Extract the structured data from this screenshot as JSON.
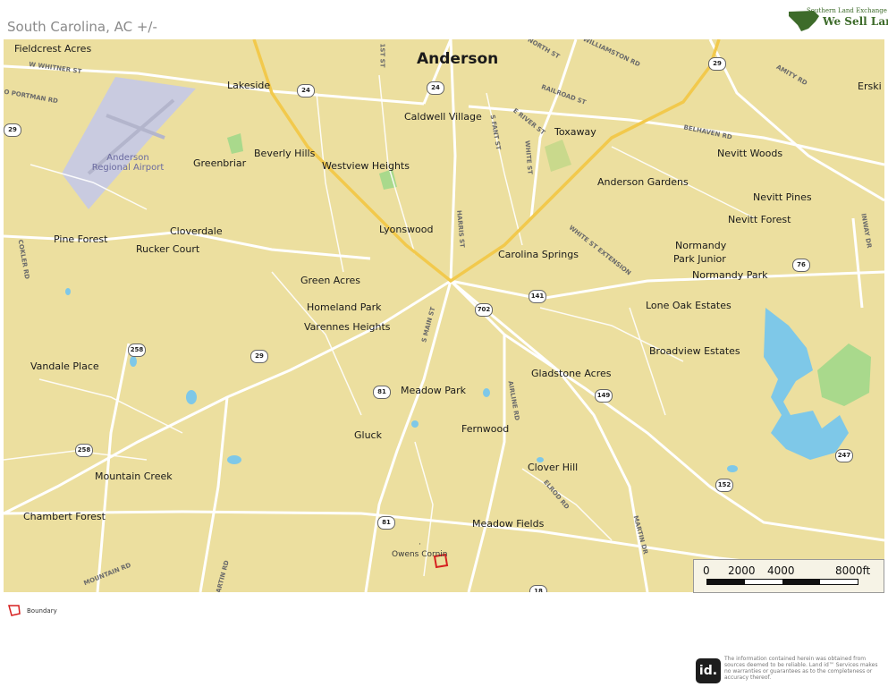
{
  "header": {
    "title": "South Carolina,  AC +/-"
  },
  "logo": {
    "tagline": "Southern Land Exchange",
    "text": "We Sell Land."
  },
  "map": {
    "city": "Anderson",
    "places": [
      "Fieldcrest Acres",
      "Lakeside",
      "Caldwell Village",
      "Toxaway",
      "Erski",
      "Beverly Hills",
      "Greenbriar",
      "Westview Heights",
      "Nevitt Woods",
      "Anderson Gardens",
      "Nevitt Pines",
      "Nevitt Forest",
      "Lyonswood",
      "Pine Forest",
      "Cloverdale",
      "Rucker Court",
      "Normandy",
      "Park Junior",
      "Carolina Springs",
      "Normandy Park",
      "Green Acres",
      "Lone Oak Estates",
      "Homeland Park",
      "Varennes Heights",
      "Broadview Estates",
      "Vandale Place",
      "Gladstone Acres",
      "Meadow Park",
      "Fernwood",
      "Gluck",
      "Clover Hill",
      "Mountain Creek",
      "Chambert Forest",
      "Meadow Fields",
      "Owens Cornin"
    ],
    "airport": {
      "line1": "Anderson",
      "line2": "Regional Airport"
    },
    "streets": [
      "W WHITNER ST",
      "O PORTMAN RD",
      "1ST ST",
      "S FANT ST",
      "E RIVER ST",
      "RAILROAD ST",
      "NORTH ST",
      "WILLIAMSTON RD",
      "AMITY RD",
      "BELHAVEN RD",
      "WHITE ST",
      "HARRIS ST",
      "WHITE ST EXTENSION",
      "S MAIN ST",
      "AIRLINE RD",
      "ELROD RD",
      "MARTIN DR",
      "INWAY DR",
      "COKLER RD",
      "MOUNTAIN RD",
      "MARTIN RD"
    ],
    "shields": [
      "24",
      "24",
      "29",
      "29",
      "702",
      "141",
      "258",
      "258",
      "81",
      "81",
      "149",
      "76",
      "152",
      "247",
      "29",
      "18"
    ]
  },
  "scale": {
    "labels": [
      "0",
      "2000",
      "4000",
      "8000ft"
    ]
  },
  "legend": {
    "label": "Boundary",
    "color": "#d62020"
  },
  "disclaimer": {
    "badge": "id.",
    "text": "The information contained herein was obtained from sources deemed to be reliable. Land id™ Services makes no warranties or guarantees as to the completeness or accuracy thereof."
  },
  "colors": {
    "land": "#ecdf9f",
    "water": "#7ec8e8",
    "park": "#a9d98c",
    "highway": "#f2c94c",
    "road": "#ffffff",
    "airport": "#c9cbe0"
  }
}
